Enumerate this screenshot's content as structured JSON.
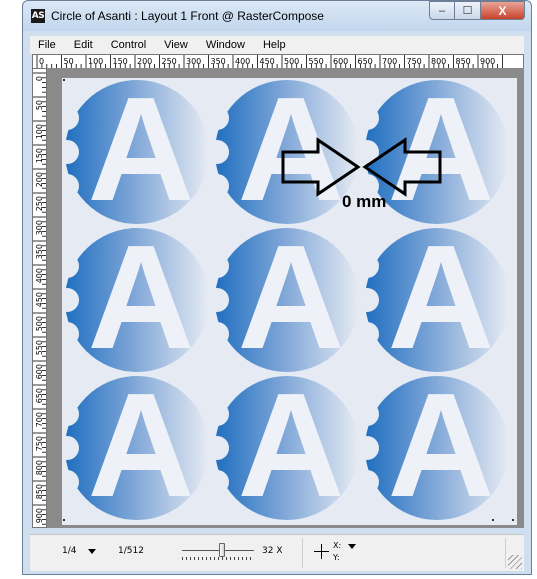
{
  "window": {
    "app_icon": "AS",
    "title": "Circle of Asanti : Layout 1 Front @ RasterCompose",
    "controls": {
      "minimize": "–",
      "maximize": "☐",
      "close": "X"
    }
  },
  "menu": [
    "File",
    "Edit",
    "Control",
    "View",
    "Window",
    "Help"
  ],
  "rulers": {
    "top_labels": [
      "0",
      "50",
      "100",
      "150",
      "200",
      "250",
      "300",
      "350",
      "400",
      "450",
      "500",
      "550",
      "600",
      "650",
      "700",
      "750",
      "800",
      "850",
      "900"
    ],
    "left_labels": [
      "0",
      "50",
      "100",
      "150",
      "200",
      "250",
      "300",
      "350",
      "400",
      "450",
      "500",
      "550",
      "600",
      "650",
      "700",
      "750",
      "800",
      "850",
      "900"
    ]
  },
  "canvas": {
    "tile_letter": "A",
    "tile_rows": 3,
    "tile_cols": 3,
    "measure_label": "0 mm",
    "colors": {
      "circle_dark": "#1f6fc0",
      "circle_light": "#e6ebf3",
      "page_bg": "#e6ebf3",
      "pasteboard": "#8a8a8a",
      "letter": "#eef2f8"
    }
  },
  "statusbar": {
    "page": "1/4",
    "zoom_min": "1/512",
    "zoom_max": "32 X",
    "zoom_level": 0.55,
    "coord_x_label": "X:",
    "coord_y_label": "Y:"
  }
}
